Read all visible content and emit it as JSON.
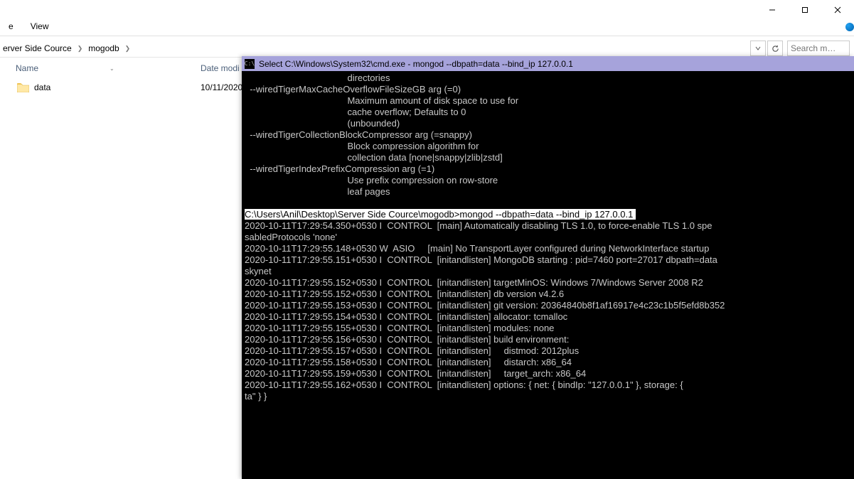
{
  "window_controls": {
    "minimize_icon": "minimize",
    "maximize_icon": "maximize",
    "close_icon": "close"
  },
  "menu": {
    "items": [
      "e",
      "View"
    ]
  },
  "breadcrumb": {
    "items": [
      "erver Side Cource",
      "mogodb"
    ]
  },
  "search": {
    "placeholder": "Search m…"
  },
  "list_header": {
    "name": "Name",
    "date": "Date modi"
  },
  "files": [
    {
      "name": "data",
      "date": "10/11/2020",
      "type": "folder"
    }
  ],
  "terminal": {
    "title": "Select C:\\Windows\\System32\\cmd.exe - mongod  --dbpath=data --bind_ip 127.0.0.1",
    "pre_lines": [
      "                                        directories",
      "  --wiredTigerMaxCacheOverflowFileSizeGB arg (=0)",
      "                                        Maximum amount of disk space to use for",
      "                                        cache overflow; Defaults to 0",
      "                                        (unbounded)",
      "  --wiredTigerCollectionBlockCompressor arg (=snappy)",
      "                                        Block compression algorithm for",
      "                                        collection data [none|snappy|zlib|zstd]",
      "  --wiredTigerIndexPrefixCompression arg (=1)",
      "                                        Use prefix compression on row-store",
      "                                        leaf pages",
      ""
    ],
    "prompt_line": "C:\\Users\\Anil\\Desktop\\Server Side Cource\\mogodb>mongod --dbpath=data --bind_ip 127.0.0.1 ",
    "post_lines": [
      "2020-10-11T17:29:54.350+0530 I  CONTROL  [main] Automatically disabling TLS 1.0, to force-enable TLS 1.0 spe",
      "sabledProtocols 'none'",
      "2020-10-11T17:29:55.148+0530 W  ASIO     [main] No TransportLayer configured during NetworkInterface startup",
      "2020-10-11T17:29:55.151+0530 I  CONTROL  [initandlisten] MongoDB starting : pid=7460 port=27017 dbpath=data ",
      "skynet",
      "2020-10-11T17:29:55.152+0530 I  CONTROL  [initandlisten] targetMinOS: Windows 7/Windows Server 2008 R2",
      "2020-10-11T17:29:55.152+0530 I  CONTROL  [initandlisten] db version v4.2.6",
      "2020-10-11T17:29:55.153+0530 I  CONTROL  [initandlisten] git version: 20364840b8f1af16917e4c23c1b5f5efd8b352",
      "2020-10-11T17:29:55.154+0530 I  CONTROL  [initandlisten] allocator: tcmalloc",
      "2020-10-11T17:29:55.155+0530 I  CONTROL  [initandlisten] modules: none",
      "2020-10-11T17:29:55.156+0530 I  CONTROL  [initandlisten] build environment:",
      "2020-10-11T17:29:55.157+0530 I  CONTROL  [initandlisten]     distmod: 2012plus",
      "2020-10-11T17:29:55.158+0530 I  CONTROL  [initandlisten]     distarch: x86_64",
      "2020-10-11T17:29:55.159+0530 I  CONTROL  [initandlisten]     target_arch: x86_64",
      "2020-10-11T17:29:55.162+0530 I  CONTROL  [initandlisten] options: { net: { bindIp: \"127.0.0.1\" }, storage: {",
      "ta\" } }"
    ]
  }
}
